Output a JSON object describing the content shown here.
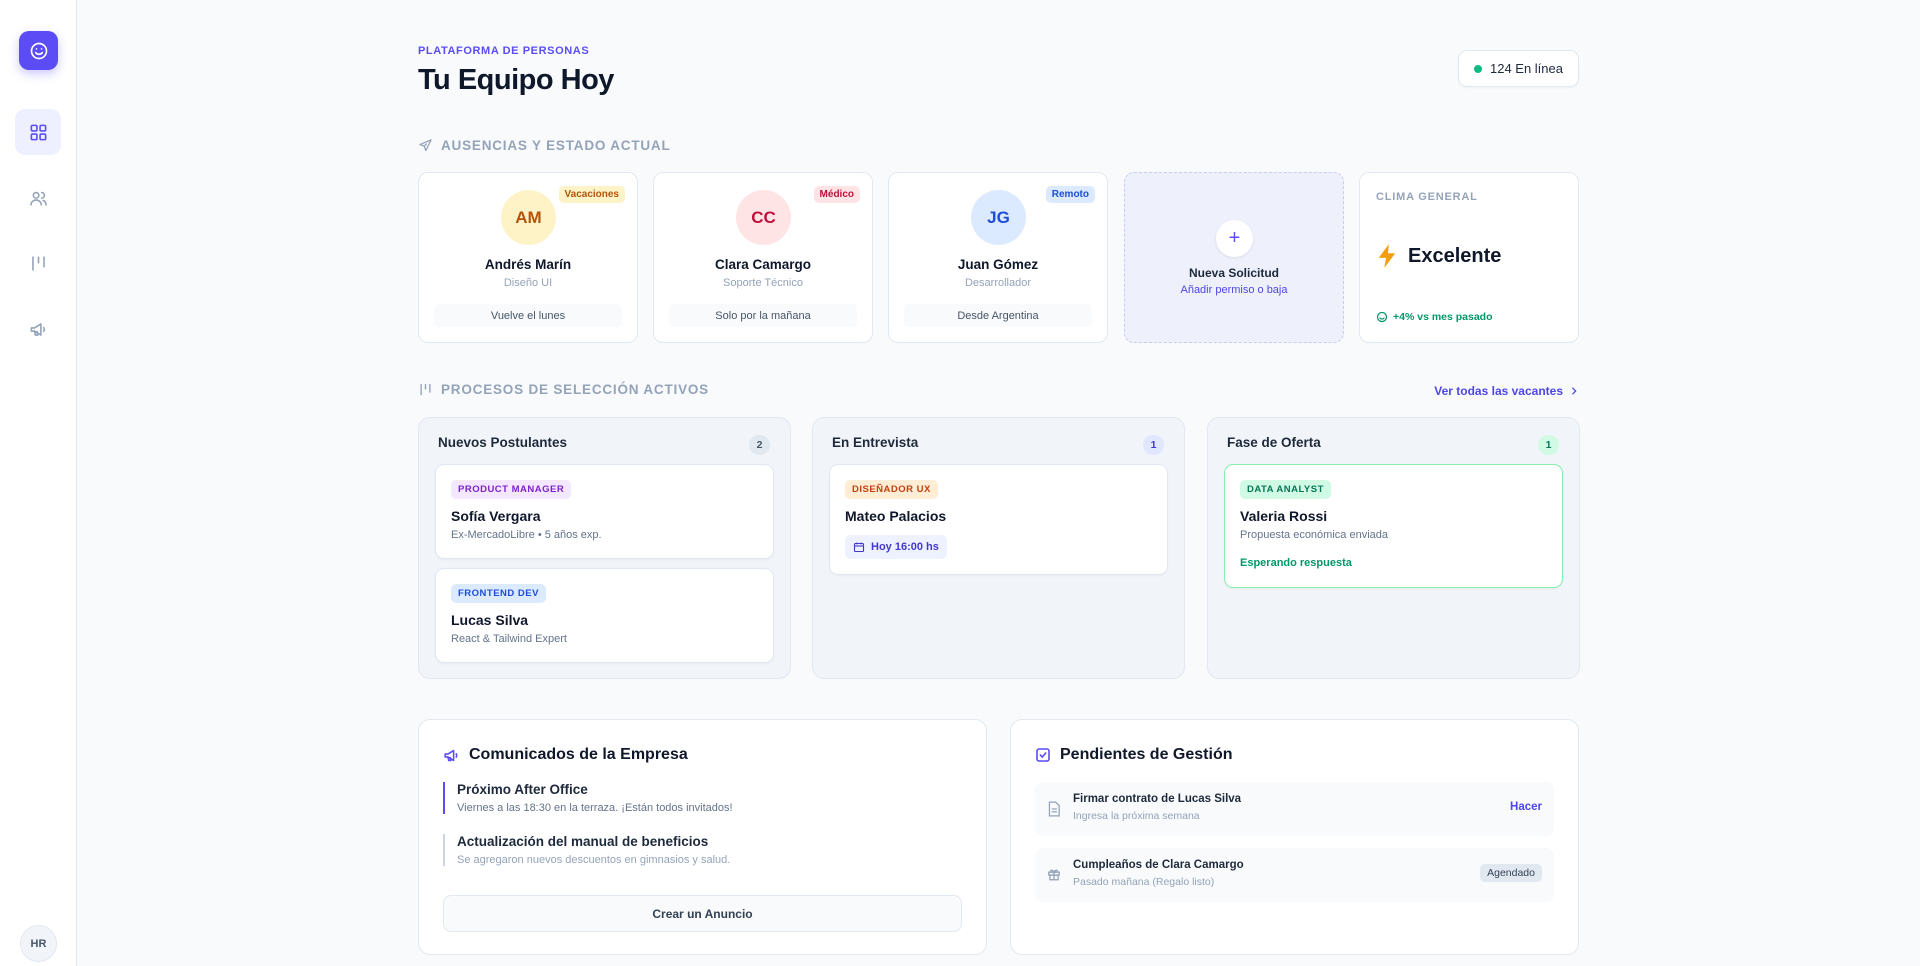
{
  "sidebar": {
    "logo_icon": "smile-icon",
    "nav": [
      {
        "icon": "grid-icon",
        "active": true
      },
      {
        "icon": "users-icon",
        "active": false
      },
      {
        "icon": "kanban-icon",
        "active": false
      },
      {
        "icon": "megaphone-icon",
        "active": false
      }
    ],
    "user_initials": "HR"
  },
  "header": {
    "eyebrow": "PLATAFORMA DE PERSONAS",
    "title": "Tu Equipo Hoy",
    "online_label": "124 En línea"
  },
  "absences": {
    "section_title": "AUSENCIAS Y ESTADO ACTUAL",
    "people": [
      {
        "initials": "AM",
        "name": "Andrés Marín",
        "role": "Diseño UI",
        "badge": "Vacaciones",
        "note": "Vuelve el lunes",
        "badge_color": "#b45309",
        "badge_bg": "#fef3c7",
        "avatar_color": "#b45309",
        "avatar_bg": "#fef3c7"
      },
      {
        "initials": "CC",
        "name": "Clara Camargo",
        "role": "Soporte Técnico",
        "badge": "Médico",
        "note": "Solo por la mañana",
        "badge_color": "#be123c",
        "badge_bg": "#ffe4e6",
        "avatar_color": "#be123c",
        "avatar_bg": "#ffe4e6"
      },
      {
        "initials": "JG",
        "name": "Juan Gómez",
        "role": "Desarrollador",
        "badge": "Remoto",
        "note": "Desde Argentina",
        "badge_color": "#1d4ed8",
        "badge_bg": "#dbeafe",
        "avatar_color": "#1d4ed8",
        "avatar_bg": "#dbeafe"
      }
    ],
    "new_request": {
      "title": "Nueva Solicitud",
      "subtitle": "Añadir permiso o baja"
    },
    "climate": {
      "label": "CLIMA GENERAL",
      "value": "Excelente",
      "trend": "+4% vs mes pasado"
    }
  },
  "pipeline": {
    "section_title": "PROCESOS DE SELECCIÓN ACTIVOS",
    "link_label": "Ver todas las vacantes",
    "columns": [
      {
        "title": "Nuevos Postulantes",
        "count": "2",
        "cards": [
          {
            "tag": "PRODUCT MANAGER",
            "name": "Sofía Vergara",
            "sub": "Ex-MercadoLibre • 5 años exp."
          },
          {
            "tag": "FRONTEND DEV",
            "name": "Lucas Silva",
            "sub": "React & Tailwind Expert"
          }
        ]
      },
      {
        "title": "En Entrevista",
        "count": "1",
        "cards": [
          {
            "tag": "DISEÑADOR UX",
            "name": "Mateo Palacios",
            "chip": "Hoy 16:00 hs"
          }
        ]
      },
      {
        "title": "Fase de Oferta",
        "count": "1",
        "cards": [
          {
            "tag": "DATA ANALYST",
            "name": "Valeria Rossi",
            "sub": "Propuesta económica enviada",
            "status": "Esperando respuesta"
          }
        ]
      }
    ]
  },
  "announcements": {
    "title": "Comunicados de la Empresa",
    "items": [
      {
        "title": "Próximo After Office",
        "body": "Viernes a las 18:30 en la terraza. ¡Están todos invitados!"
      },
      {
        "title": "Actualización del manual de beneficios",
        "body": "Se agregaron nuevos descuentos en gimnasios y salud."
      }
    ],
    "button_label": "Crear un Anuncio"
  },
  "tasks": {
    "title": "Pendientes de Gestión",
    "items": [
      {
        "title": "Firmar contrato de Lucas Silva",
        "sub": "Ingresa la próxima semana",
        "action": "Hacer"
      },
      {
        "title": "Cumpleaños de Clara Camargo",
        "sub": "Pasado mañana (Regalo listo)",
        "badge": "Agendado"
      }
    ]
  }
}
